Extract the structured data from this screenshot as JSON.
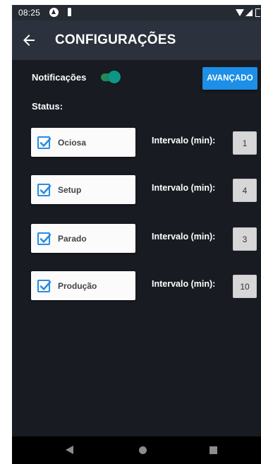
{
  "status_bar": {
    "time": "08:25"
  },
  "app_bar": {
    "title": "CONFIGURAÇÕES"
  },
  "settings": {
    "notifications_label": "Notificações",
    "notifications_enabled": true,
    "advanced_button": "AVANÇADO",
    "status_label": "Status:"
  },
  "status_items": [
    {
      "label": "Ociosa",
      "checked": true,
      "interval_label": "Intervalo (min):",
      "interval_value": "1"
    },
    {
      "label": "Setup",
      "checked": true,
      "interval_label": "Intervalo (min):",
      "interval_value": "4"
    },
    {
      "label": "Parado",
      "checked": true,
      "interval_label": "Intervalo (min):",
      "interval_value": "3"
    },
    {
      "label": "Produção",
      "checked": true,
      "interval_label": "Intervalo (min):",
      "interval_value": "10"
    }
  ],
  "colors": {
    "background": "#181b22",
    "app_bar": "#2b313d",
    "accent_button": "#1d8fe6",
    "toggle_on": "#0e9685",
    "checkbox": "#2a8be0"
  },
  "icons": {
    "back": "arrow-left-icon",
    "checkbox": "checkbox-checked-icon",
    "nav_back": "triangle-back-icon",
    "nav_home": "circle-home-icon",
    "nav_recents": "square-recents-icon"
  }
}
